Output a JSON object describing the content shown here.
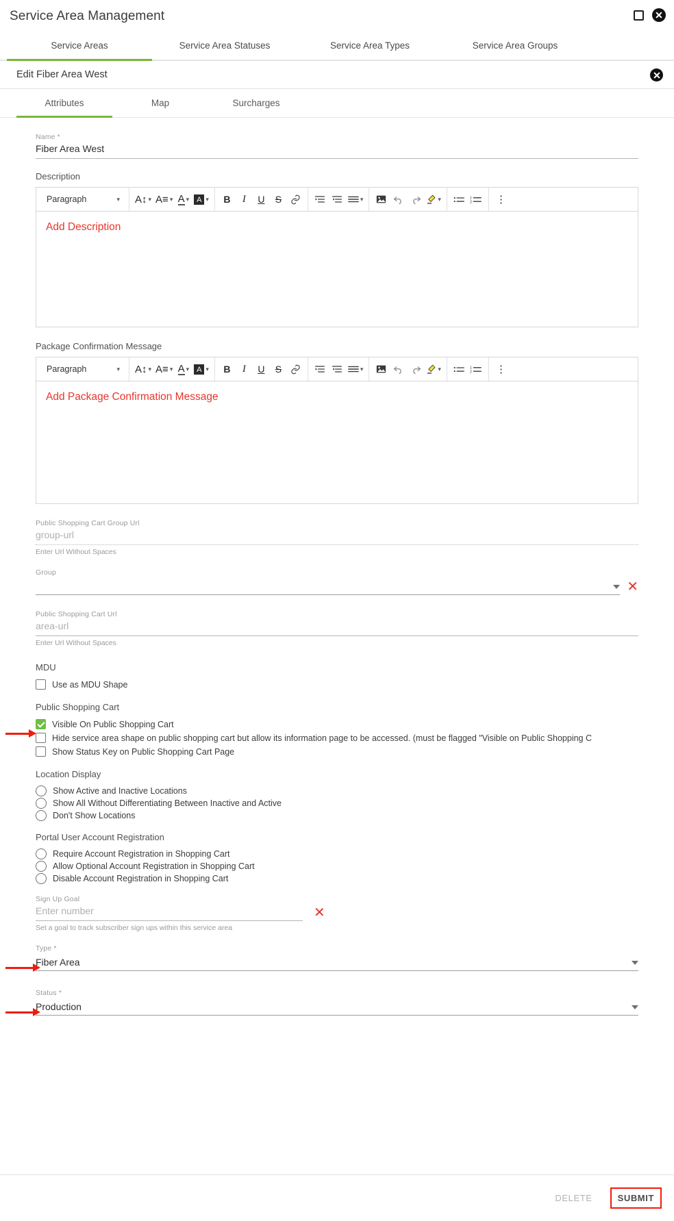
{
  "window": {
    "title": "Service Area Management",
    "maximize_icon": "maximize-icon",
    "close_icon": "close-circle-icon"
  },
  "top_tabs": [
    {
      "label": "Service Areas",
      "active": true
    },
    {
      "label": "Service Area Statuses",
      "active": false
    },
    {
      "label": "Service Area Types",
      "active": false
    },
    {
      "label": "Service Area Groups",
      "active": false
    }
  ],
  "edit_bar": {
    "title": "Edit Fiber Area West",
    "close_icon": "close-circle-icon"
  },
  "inner_tabs": [
    {
      "label": "Attributes",
      "active": true
    },
    {
      "label": "Map",
      "active": false
    },
    {
      "label": "Surcharges",
      "active": false
    }
  ],
  "fields": {
    "name": {
      "label": "Name *",
      "value": "Fiber Area West"
    },
    "description": {
      "label": "Description",
      "placeholder": "Add Description"
    },
    "package_confirmation": {
      "label": "Package Confirmation Message",
      "placeholder": "Add Package Confirmation Message"
    },
    "group_url": {
      "label": "Public Shopping Cart Group Url",
      "placeholder": "group-url",
      "hint": "Enter Url Without Spaces"
    },
    "group": {
      "label": "Group",
      "value": "",
      "clear_icon": "clear-x-icon"
    },
    "area_url": {
      "label": "Public Shopping Cart Url",
      "placeholder": "area-url",
      "hint": "Enter Url Without Spaces"
    },
    "sign_up_goal": {
      "label": "Sign Up Goal",
      "placeholder": "Enter number",
      "hint": "Set a goal to track subscriber sign ups within this service area",
      "clear_icon": "clear-x-icon"
    },
    "type": {
      "label": "Type *",
      "value": "Fiber Area"
    },
    "status": {
      "label": "Status *",
      "value": "Production"
    }
  },
  "editor_toolbar": {
    "paragraph_label": "Paragraph",
    "buttons": [
      {
        "name": "font-size-icon",
        "glyph": "A↕",
        "caret": true
      },
      {
        "name": "line-height-icon",
        "glyph": "A☰",
        "caret": true
      },
      {
        "name": "font-color-icon",
        "glyph": "A",
        "caret": true
      },
      {
        "name": "background-color-icon",
        "glyph": "A",
        "caret": true
      },
      {
        "name": "bold-icon",
        "glyph": "B",
        "caret": false
      },
      {
        "name": "italic-icon",
        "glyph": "I",
        "caret": false
      },
      {
        "name": "underline-icon",
        "glyph": "U",
        "caret": false
      },
      {
        "name": "strikethrough-icon",
        "glyph": "S",
        "caret": false
      },
      {
        "name": "link-icon",
        "glyph": "🔗",
        "caret": false
      },
      {
        "name": "indent-increase-icon",
        "glyph": "→≡",
        "caret": false
      },
      {
        "name": "indent-decrease-icon",
        "glyph": "←≡",
        "caret": false
      },
      {
        "name": "align-icon",
        "glyph": "≡",
        "caret": true
      },
      {
        "name": "insert-image-icon",
        "glyph": "🖼",
        "caret": false
      },
      {
        "name": "undo-icon",
        "glyph": "↶",
        "caret": false
      },
      {
        "name": "redo-icon",
        "glyph": "↷",
        "caret": false
      },
      {
        "name": "highlighter-icon",
        "glyph": "✏",
        "caret": true
      },
      {
        "name": "bulleted-list-icon",
        "glyph": "•≡",
        "caret": false
      },
      {
        "name": "numbered-list-icon",
        "glyph": "1≡",
        "caret": false
      },
      {
        "name": "more-options-icon",
        "glyph": "⋮",
        "caret": false
      }
    ]
  },
  "mdu": {
    "section_label": "MDU",
    "options": [
      {
        "label": "Use as MDU Shape",
        "checked": false
      }
    ]
  },
  "public_shopping_cart": {
    "section_label": "Public Shopping Cart",
    "options": [
      {
        "label": "Visible On Public Shopping Cart",
        "checked": true,
        "annotated": true
      },
      {
        "label": "Hide service area shape on public shopping cart but allow its information page to be accessed. (must be flagged \"Visible on Public Shopping C",
        "checked": false,
        "annotated": false
      },
      {
        "label": "Show Status Key on Public Shopping Cart Page",
        "checked": false,
        "annotated": false
      }
    ]
  },
  "location_display": {
    "section_label": "Location Display",
    "options": [
      {
        "label": "Show Active and Inactive Locations",
        "selected": false
      },
      {
        "label": "Show All Without Differentiating Between Inactive and Active",
        "selected": false
      },
      {
        "label": "Don't Show Locations",
        "selected": false
      }
    ]
  },
  "portal_registration": {
    "section_label": "Portal User Account Registration",
    "options": [
      {
        "label": "Require Account Registration in Shopping Cart",
        "selected": false
      },
      {
        "label": "Allow Optional Account Registration in Shopping Cart",
        "selected": false
      },
      {
        "label": "Disable Account Registration in Shopping Cart",
        "selected": false
      }
    ]
  },
  "footer": {
    "delete_label": "DELETE",
    "submit_label": "SUBMIT"
  },
  "colors": {
    "accent_green": "#79b63b",
    "checkbox_green": "#6fbe44",
    "annotation_red": "#f01c0d",
    "placeholder_red": "#e8352b"
  }
}
